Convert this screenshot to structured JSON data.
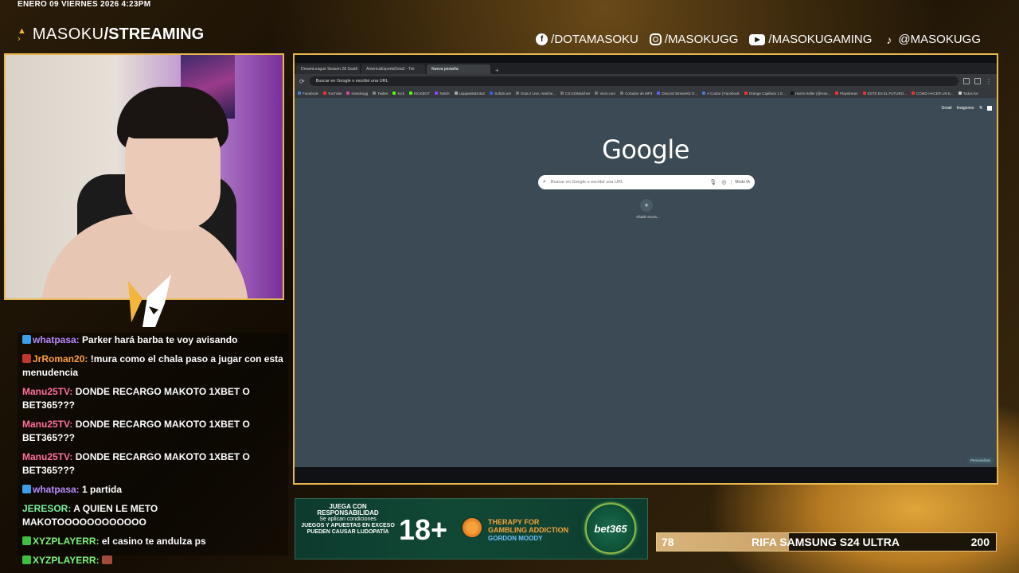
{
  "overlay": {
    "datetime": "ENERO 09 VIERNES 2026 4:23PM",
    "brand_name": "MASOKU",
    "brand_sep": " / ",
    "brand_section": "STREAMING",
    "socials": [
      {
        "icon": "facebook-icon",
        "label": "/DOTAMASOKU"
      },
      {
        "icon": "instagram-icon",
        "label": "/MASOKUGG"
      },
      {
        "icon": "youtube-icon",
        "label": "/MASOKUGAMING"
      },
      {
        "icon": "tiktok-icon",
        "label": "@MASOKUGG"
      }
    ],
    "accent": "#e8b850"
  },
  "chat": [
    {
      "user": "whatpasa:",
      "text": "Parker hará barba te voy avisando",
      "color": "#b98bff",
      "badge": "#3aa0e8"
    },
    {
      "user": "JrRoman20:",
      "text": "!mura como el chala paso a jugar con esta menudencia",
      "color": "#ff9f43",
      "badge": "#c0392b"
    },
    {
      "user": "Manu25TV:",
      "text": "DONDE RECARGO MAKOTO 1XBET O BET365???",
      "color": "#ff6f9a",
      "badge": ""
    },
    {
      "user": "Manu25TV:",
      "text": "DONDE RECARGO MAKOTO 1XBET O BET365???",
      "color": "#ff6f9a",
      "badge": ""
    },
    {
      "user": "Manu25TV:",
      "text": "DONDE RECARGO MAKOTO 1XBET O BET365???",
      "color": "#ff6f9a",
      "badge": ""
    },
    {
      "user": "whatpasa:",
      "text": "1 partida",
      "color": "#b98bff",
      "badge": "#3aa0e8"
    },
    {
      "user": "JERESOR:",
      "text": "A QUIEN LE METO MAKOTOOOOOOOOOOOO",
      "color": "#7ef0a0",
      "badge": ""
    },
    {
      "user": "XYZPLAYERR:",
      "text": "el casino te andulza ps",
      "color": "#7ef07a",
      "badge": "#3fbf3f"
    },
    {
      "user": "XYZPLAYERR:",
      "text": "",
      "color": "#7ef07a",
      "badge": "#3fbf3f"
    }
  ],
  "browser": {
    "tabs": [
      {
        "title": "DreamLeague Season 28 South"
      },
      {
        "title": "AmericaEsportsDota2 - Twi"
      },
      {
        "title": "Nueva pestaña",
        "active": true
      }
    ],
    "address_placeholder": "Buscar en Google o escribir una URL",
    "bookmarks": [
      "Facebook",
      "YouTube",
      "masokugg",
      "Twitter",
      "Kick",
      "KICKBOT",
      "Twitch",
      "LiquipediaDota2",
      "SofaScore",
      "Dota 2 Live, matche...",
      "CS:GOMatches",
      "Vivo!.com",
      "Cortador de MP3",
      "Discord StreamKit O...",
      "A Costar | Facebook",
      "Orange Capibuto 1 E...",
      "Harris Heller (@Han...",
      "Playstream",
      "ESTE ES EL FUTURO...",
      "CÓMO HACER UN E...",
      "Todos los"
    ],
    "top_links": [
      "Gmail",
      "Imágenes"
    ],
    "google_logo": "Google",
    "search_placeholder": "Buscar en Google o escribir una URL",
    "mode_label": "Modo IA",
    "shortcut_label": "Añadir acces...",
    "customize_label": "Personalizar"
  },
  "ad": {
    "line1": "JUEGA CON RESPONSABILIDAD",
    "line2": "Se aplican condiciones",
    "line3": "JUEGOS Y APUESTAS EN EXCESO",
    "line4": "PUEDEN CAUSAR LUDOPATÍA",
    "age": "18+",
    "therapy_line1": "THERAPY FOR",
    "therapy_line2": "GAMBLING ADDICTION",
    "gordon": "GORDON MOODY",
    "brand": "bet365"
  },
  "raffle": {
    "left": "78",
    "title": "RIFA SAMSUNG S24 ULTRA",
    "right": "200",
    "progress": 0.39
  }
}
